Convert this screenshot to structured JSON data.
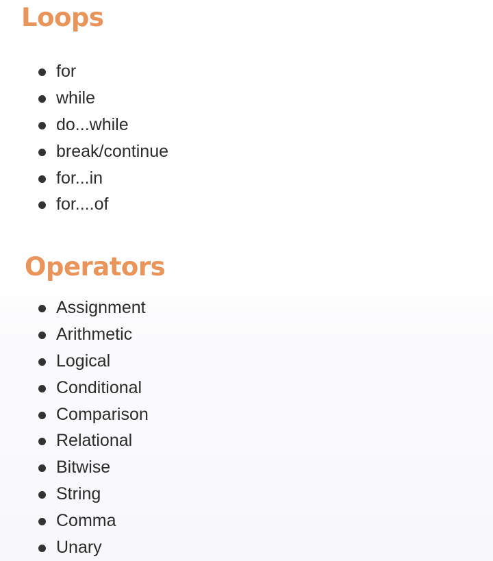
{
  "colors": {
    "heading": "#e8945a",
    "text": "#2b2b2b",
    "bullet": "#333333"
  },
  "loops": {
    "title": "Loops",
    "items": [
      "for",
      "while",
      "do...while",
      "break/continue",
      "for...in",
      "for....of"
    ]
  },
  "operators": {
    "title": "Operators",
    "items": [
      "Assignment",
      "Arithmetic",
      "Logical",
      "Conditional",
      "Comparison",
      "Relational",
      "Bitwise",
      "String",
      "Comma",
      "Unary"
    ]
  }
}
